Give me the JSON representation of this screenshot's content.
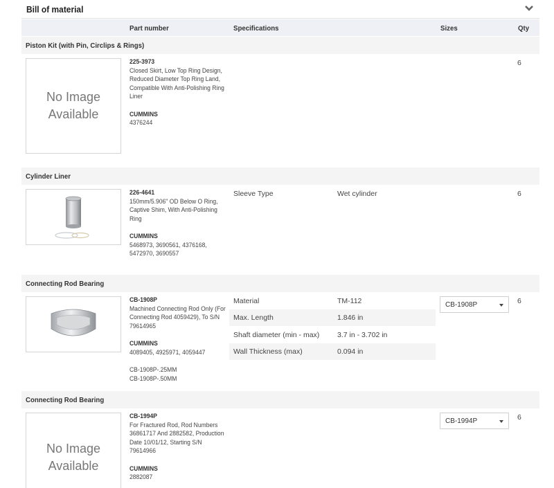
{
  "panel": {
    "title": "Bill of material"
  },
  "columns": {
    "part_number": "Part number",
    "specifications": "Specifications",
    "sizes": "Sizes",
    "qty": "Qty"
  },
  "groups": [
    {
      "name": "Piston Kit (with Pin, Circlips & Rings)",
      "part_number": "225-3973",
      "description": "Closed Skirt, Low Top Ring Design, Reduced Diameter Top Ring Land, Compatible With Anti-Polishing Ring Liner",
      "brand": "CUMMINS",
      "compat": "4376244",
      "image_text_1": "No Image",
      "image_text_2": "Available",
      "qty": "6"
    },
    {
      "name": "Cylinder Liner",
      "part_number": "226-4641",
      "description": "150mm/5.906\" OD Below O Ring, Captive Shim, With Anti-Polishing Ring",
      "brand": "CUMMINS",
      "compat": "5468973, 3690561, 4376168, 5472970, 3690557",
      "specs": [
        {
          "key": "Sleeve Type",
          "value": "Wet cylinder"
        }
      ],
      "qty": "6"
    },
    {
      "name": "Connecting Rod Bearing",
      "part_number": "CB-1908P",
      "description": "Machined Connecting Rod Only (For Connecting Rod 4059429), To S/N 79614965",
      "brand": "CUMMINS",
      "compat": "4089405, 4925971, 4059447",
      "alternates": [
        "CB-1908P-.25MM",
        "CB-1908P-.50MM"
      ],
      "specs": [
        {
          "key": "Material",
          "value": "TM-112"
        },
        {
          "key": "Max. Length",
          "value": "1.846 in"
        },
        {
          "key": "Shaft diameter (min - max)",
          "value": "3.7 in - 3.702 in"
        },
        {
          "key": "Wall Thickness (max)",
          "value": "0.094 in"
        }
      ],
      "size_selected": "CB-1908P",
      "qty": "6"
    },
    {
      "name": "Connecting Rod Bearing",
      "part_number": "CB-1994P",
      "description": "For Fractured Rod, Rod Numbers 36861717 And 2882582, Production Date 10/01/12, Starting S/N 79614966",
      "brand": "CUMMINS",
      "compat": "2882087",
      "image_text_1": "No Image",
      "image_text_2": "Available",
      "size_selected": "CB-1994P",
      "qty": "6"
    }
  ]
}
